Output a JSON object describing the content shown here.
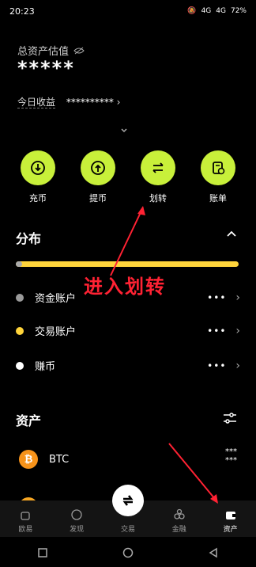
{
  "status": {
    "time": "20:23",
    "battery": "72%",
    "net1": "4G",
    "net2": "4G"
  },
  "header": {
    "asset_label": "总资产估值",
    "asset_value": "*****",
    "today_label": "今日收益",
    "today_value": "**********",
    "today_arrow": "›"
  },
  "actions": [
    {
      "label": "充币",
      "icon": "deposit-icon"
    },
    {
      "label": "提币",
      "icon": "withdraw-icon"
    },
    {
      "label": "划转",
      "icon": "transfer-icon"
    },
    {
      "label": "账单",
      "icon": "bill-icon"
    }
  ],
  "distribution": {
    "title": "分布",
    "collapse_icon": "chevron-up-icon"
  },
  "annotation": {
    "text": "进入划转",
    "color": "#ff2233"
  },
  "accounts": [
    {
      "name": "资金账户",
      "dot_color": "#9a9a9a",
      "more": "•••",
      "arrow": "›"
    },
    {
      "name": "交易账户",
      "dot_color": "#ffd43b",
      "more": "•••",
      "arrow": "›"
    },
    {
      "name": "赚币",
      "dot_color": "#ffffff",
      "more": "•••",
      "arrow": "›"
    }
  ],
  "assets": {
    "title": "资产",
    "filter_icon": "filter-icon",
    "coin": "BTC",
    "coin_symbol": "₿",
    "coin_more_1": "***",
    "coin_more_2": "***"
  },
  "tabs": [
    {
      "label": "欧易",
      "icon": "home-icon"
    },
    {
      "label": "发现",
      "icon": "discover-icon"
    },
    {
      "label": "交易",
      "icon": "trade-icon"
    },
    {
      "label": "金融",
      "icon": "finance-icon"
    },
    {
      "label": "资产",
      "icon": "wallet-icon"
    }
  ],
  "colors": {
    "accent": "#c8f03a",
    "bar": "#ffd43b",
    "annotation": "#ff2233"
  }
}
